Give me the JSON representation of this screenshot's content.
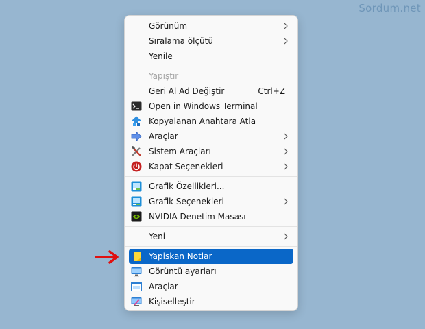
{
  "watermark": "Sordum.net",
  "menu": {
    "group1": [
      {
        "label": "Görünüm",
        "submenu": true
      },
      {
        "label": "Sıralama ölçütü",
        "submenu": true
      },
      {
        "label": "Yenile"
      }
    ],
    "group2": [
      {
        "label": "Yapıştır",
        "disabled": true
      },
      {
        "label": "Geri Al Ad Değiştir",
        "shortcut": "Ctrl+Z"
      },
      {
        "label": "Open in Windows Terminal",
        "icon": "terminal-icon"
      },
      {
        "label": "Kopyalanan Anahtara Atla",
        "icon": "registry-jump-icon"
      },
      {
        "label": "Araçlar",
        "icon": "tools-arrow-icon",
        "submenu": true
      },
      {
        "label": "Sistem Araçları",
        "icon": "wrench-hammer-icon",
        "submenu": true
      },
      {
        "label": "Kapat Seçenekleri",
        "icon": "power-icon",
        "submenu": true
      }
    ],
    "group3": [
      {
        "label": "Grafik Özellikleri...",
        "icon": "intel-graphics-icon"
      },
      {
        "label": "Grafik Seçenekleri",
        "icon": "intel-graphics-icon",
        "submenu": true
      },
      {
        "label": "NVIDIA Denetim Masası",
        "icon": "nvidia-icon"
      }
    ],
    "group4": [
      {
        "label": "Yeni",
        "submenu": true
      }
    ],
    "group5": [
      {
        "label": "Yapiskan Notlar",
        "icon": "sticky-notes-icon",
        "highlighted": true
      },
      {
        "label": "Görüntü ayarları",
        "icon": "display-icon"
      },
      {
        "label": "Araçlar",
        "icon": "tools-window-icon"
      },
      {
        "label": "Kişiselleştir",
        "icon": "personalize-icon"
      }
    ]
  },
  "colors": {
    "desktop": "#97b6d0",
    "highlight": "#0a67c8",
    "pointer_arrow": "#e01010"
  }
}
